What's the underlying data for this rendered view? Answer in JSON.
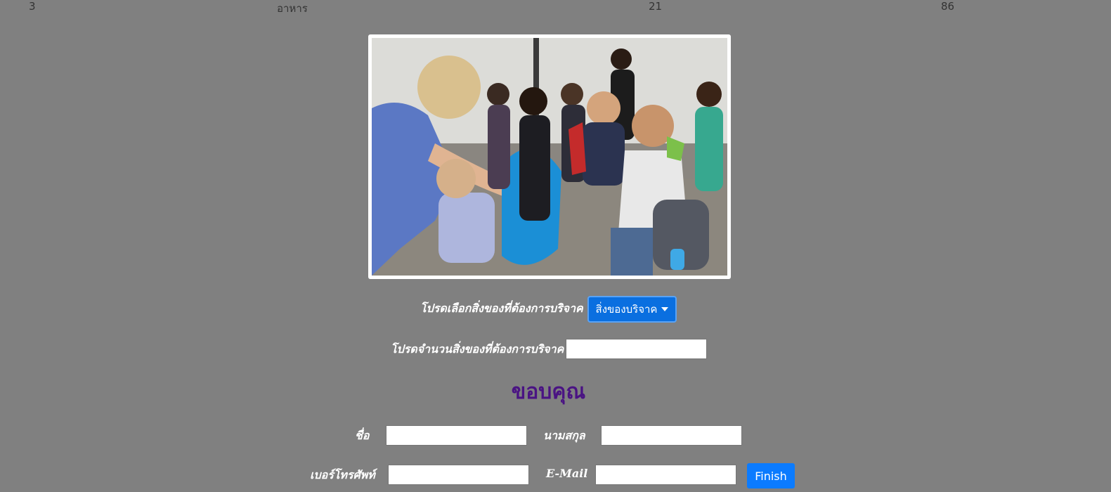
{
  "table_row": {
    "col1": "3",
    "col2": "อาหาร",
    "col3": "21",
    "col4": "86"
  },
  "photo": {
    "icon": "donation-photo"
  },
  "donation": {
    "select_label": "โปรดเลือกสิ่งของที่ต้องการบริจาค",
    "dropdown_label": "สิ่งของบริจาค",
    "quantity_label": "โปรดจำนวนสิ่งของที่ต้องการบริจาค",
    "quantity_value": ""
  },
  "thanks": "ขอบคุณ",
  "form": {
    "first_name_label": "ชื่อ",
    "first_name_value": "",
    "last_name_label": "นามสกุล",
    "last_name_value": "",
    "phone_label": "เบอร์โทรศัพท์",
    "phone_value": "",
    "email_label": "E-Mail",
    "email_value": "",
    "finish_label": "Finish"
  },
  "colors": {
    "background": "#808080",
    "primary_button": "#0a6fe0",
    "thanks_text": "#4a1383"
  }
}
